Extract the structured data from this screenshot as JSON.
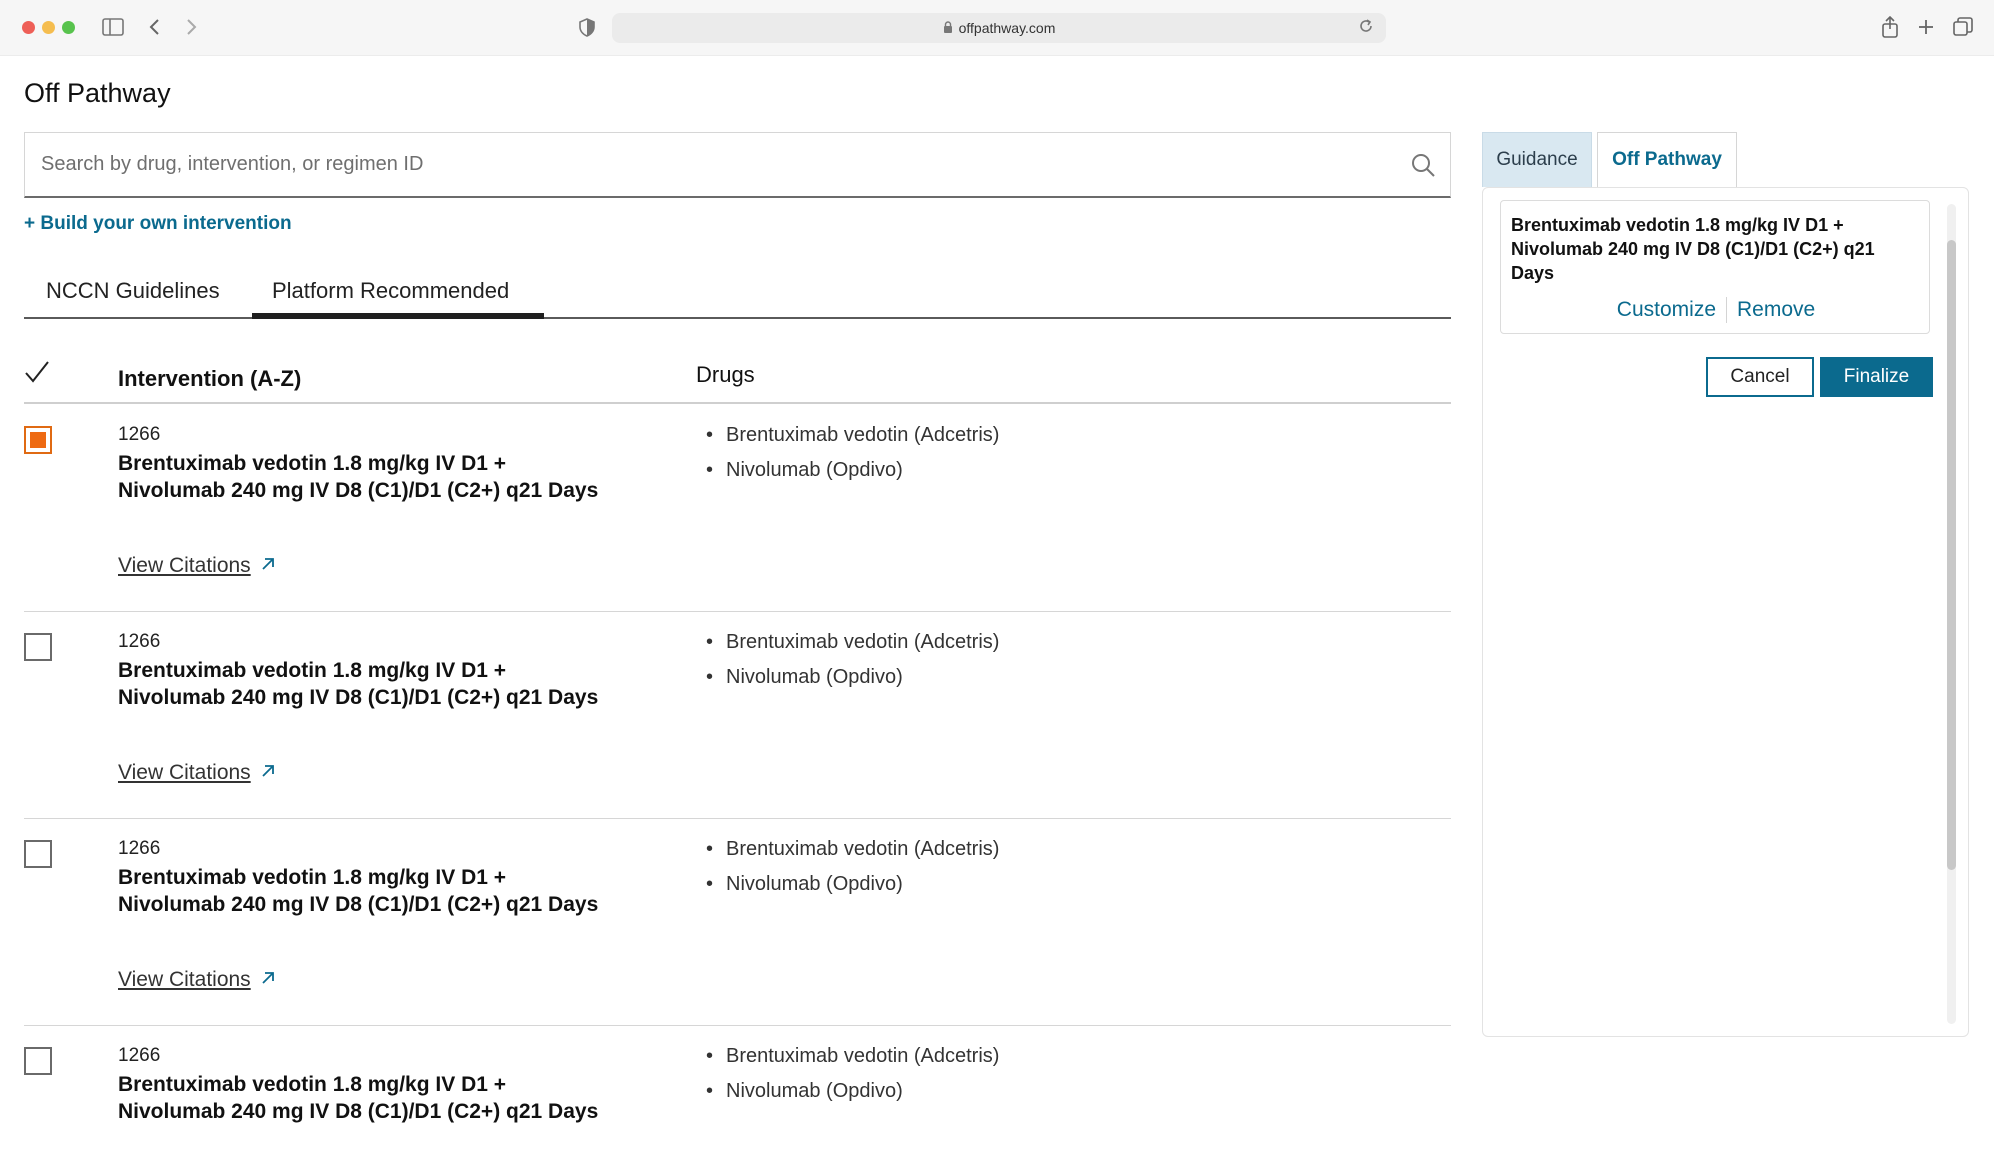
{
  "browser": {
    "url": "offpathway.com"
  },
  "page": {
    "title": "Off Pathway"
  },
  "search": {
    "placeholder": "Search by drug, intervention, or regimen ID",
    "value": ""
  },
  "build_link": "+ Build your own intervention",
  "tabs": [
    {
      "label": "NCCN Guidelines",
      "active": false
    },
    {
      "label": "Platform Recommended",
      "active": true
    }
  ],
  "table": {
    "headers": {
      "intervention": "Intervention (A-Z)",
      "drugs": "Drugs"
    },
    "rows": [
      {
        "id": "1266",
        "title": "Brentuximab vedotin 1.8 mg/kg IV D1 + Nivolumab 240 mg IV D8 (C1)/D1 (C2+) q21 Days",
        "citations_label": "View Citations",
        "drugs": [
          "Brentuximab vedotin (Adcetris)",
          "Nivolumab (Opdivo)"
        ],
        "checked": true
      },
      {
        "id": "1266",
        "title": "Brentuximab vedotin 1.8 mg/kg IV D1 + Nivolumab 240 mg IV D8 (C1)/D1 (C2+) q21 Days",
        "citations_label": "View Citations",
        "drugs": [
          "Brentuximab vedotin (Adcetris)",
          "Nivolumab (Opdivo)"
        ],
        "checked": false
      },
      {
        "id": "1266",
        "title": "Brentuximab vedotin 1.8 mg/kg IV D1 + Nivolumab 240 mg IV D8 (C1)/D1 (C2+) q21 Days",
        "citations_label": "View Citations",
        "drugs": [
          "Brentuximab vedotin (Adcetris)",
          "Nivolumab (Opdivo)"
        ],
        "checked": false
      },
      {
        "id": "1266",
        "title": "Brentuximab vedotin 1.8 mg/kg IV D1 + Nivolumab 240 mg IV D8 (C1)/D1 (C2+) q21 Days",
        "drugs": [
          "Brentuximab vedotin (Adcetris)",
          "Nivolumab (Opdivo)"
        ],
        "checked": false
      }
    ]
  },
  "right_panel": {
    "tabs": [
      {
        "label": "Guidance",
        "active": false
      },
      {
        "label": "Off Pathway",
        "active": true
      }
    ],
    "selected": {
      "title": "Brentuximab vedotin 1.8 mg/kg IV D1 + Nivolumab 240 mg IV D8 (C1)/D1 (C2+) q21 Days",
      "customize_label": "Customize",
      "remove_label": "Remove"
    },
    "cancel_label": "Cancel",
    "finalize_label": "Finalize"
  },
  "colors": {
    "accent": "#0b6a8e",
    "checkbox_checked": "#ee6a12",
    "guidance_tab_bg": "#d9e8f1"
  }
}
